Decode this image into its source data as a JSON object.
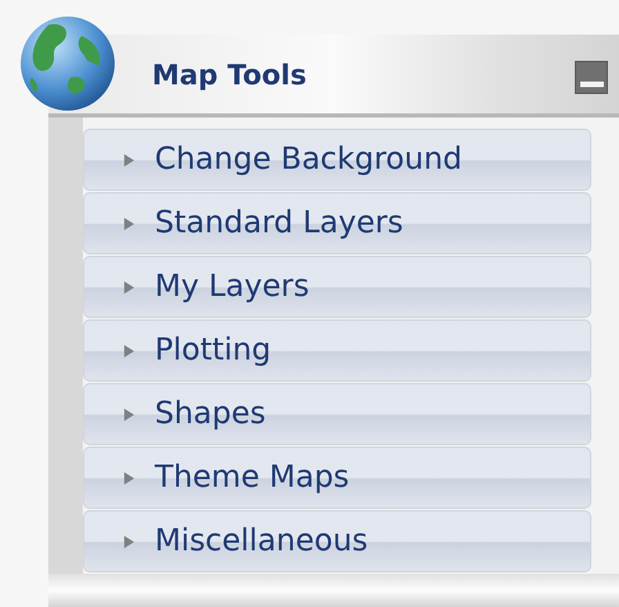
{
  "panel": {
    "title": "Map Tools",
    "items": [
      {
        "label": "Change Background",
        "expanded": false
      },
      {
        "label": "Standard Layers",
        "expanded": false
      },
      {
        "label": "My Layers",
        "expanded": false
      },
      {
        "label": "Plotting",
        "expanded": false
      },
      {
        "label": "Shapes",
        "expanded": false
      },
      {
        "label": "Theme Maps",
        "expanded": false
      },
      {
        "label": "Miscellaneous",
        "expanded": false
      }
    ]
  }
}
